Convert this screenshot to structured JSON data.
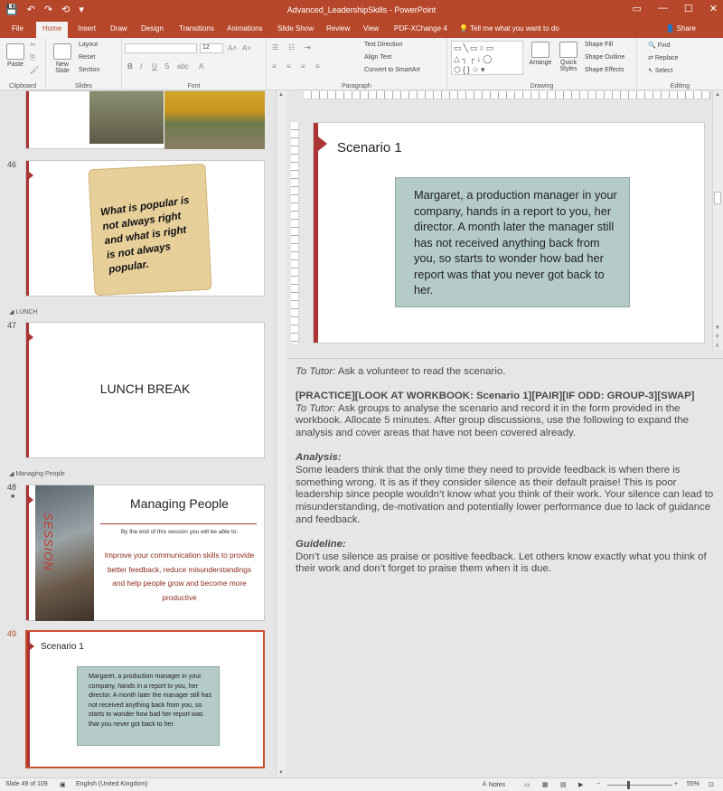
{
  "titlebar": {
    "title": "Advanced_LeadershipSkills  -  PowerPoint",
    "qat": [
      "💾",
      "↶",
      "↷",
      "⟲",
      "▾"
    ],
    "controls": [
      "▭",
      "—",
      "☐",
      "✕"
    ]
  },
  "tabs": [
    "File",
    "Home",
    "Insert",
    "Draw",
    "Design",
    "Transitions",
    "Animations",
    "Slide Show",
    "Review",
    "View",
    "PDF-XChange 4"
  ],
  "active_tab": "Home",
  "tell_me": "Tell me what you want to do",
  "share": "Share",
  "ribbon": {
    "clipboard": {
      "paste": "Paste",
      "label": "Clipboard"
    },
    "slides": {
      "new_slide": "New Slide",
      "layout": "Layout",
      "reset": "Reset",
      "section": "Section",
      "label": "Slides"
    },
    "font": {
      "size": "12",
      "label": "Font"
    },
    "paragraph": {
      "text_direction": "Text Direction",
      "align_text": "Align Text",
      "smartart": "Convert to SmartArt",
      "label": "Paragraph"
    },
    "drawing": {
      "arrange": "Arrange",
      "quick_styles": "Quick Styles",
      "shape_fill": "Shape Fill",
      "shape_outline": "Shape Outline",
      "shape_effects": "Shape Effects",
      "label": "Drawing"
    },
    "editing": {
      "find": "Find",
      "replace": "Replace",
      "select": "Select",
      "label": "Editing"
    }
  },
  "thumbnails": {
    "slide46": {
      "num": "46",
      "text": "What is popular is not always right and what is right is not always popular."
    },
    "section_lunch": "LUNCH",
    "slide47": {
      "num": "47",
      "text": "LUNCH BREAK"
    },
    "section_people": "Managing People",
    "slide48": {
      "num": "48",
      "star": "★",
      "title": "Managing People",
      "session": "SESSION",
      "intro": "By the end of this session you will be able to:",
      "body": "Improve your communication skills to provide better feedback, reduce misunderstandings and help people grow and become more productive"
    },
    "slide49": {
      "num": "49",
      "title": "Scenario 1",
      "body": "Margaret, a production manager in your company, hands in a report to you, her director. A month later the manager still has not received anything back from you, so starts to wonder how bad her report was that you never got back to her."
    }
  },
  "main_slide": {
    "title": "Scenario 1",
    "body": "Margaret, a production manager in your company, hands in a report to you, her director. A month later the manager still has not received anything back from you, so starts to wonder how bad her report was that you never got back to her."
  },
  "notes": {
    "p1_label": "To Tutor:",
    "p1_text": " Ask a volunteer to read the scenario.",
    "p2_heading": "[PRACTICE][LOOK AT WORKBOOK: Scenario 1][PAIR][IF ODD: GROUP-3][SWAP]",
    "p2_label": "To Tutor:",
    "p2_text": " Ask groups to analyse the scenario and record it in the form provided in the workbook. Allocate 5 minutes. After group discussions, use the following to expand the analysis and cover areas that have not been covered already.",
    "p3_heading": "Analysis:",
    "p3_text": "Some leaders think that the only time they need to provide feedback is when there is something wrong. It is as if they consider silence as their default praise! This is poor leadership since people wouldn’t know what you think of their work. Your silence can lead to misunderstanding, de-motivation and potentially lower performance due to lack of guidance and feedback.",
    "p4_heading": "Guideline:",
    "p4_text": "Don’t use silence as praise or positive feedback. Let others know exactly what you think of their work and don’t forget to praise them when it is due."
  },
  "statusbar": {
    "slide_info": "Slide 49 of 109",
    "language": "English (United Kingdom)",
    "notes": "Notes",
    "zoom": "55%"
  },
  "colors": {
    "accent": "#b7472a",
    "slide_red": "#a33333",
    "callout_fill": "#b4cbc8",
    "callout_border": "#8fa9a5",
    "managing_text": "#8b2a1e"
  }
}
